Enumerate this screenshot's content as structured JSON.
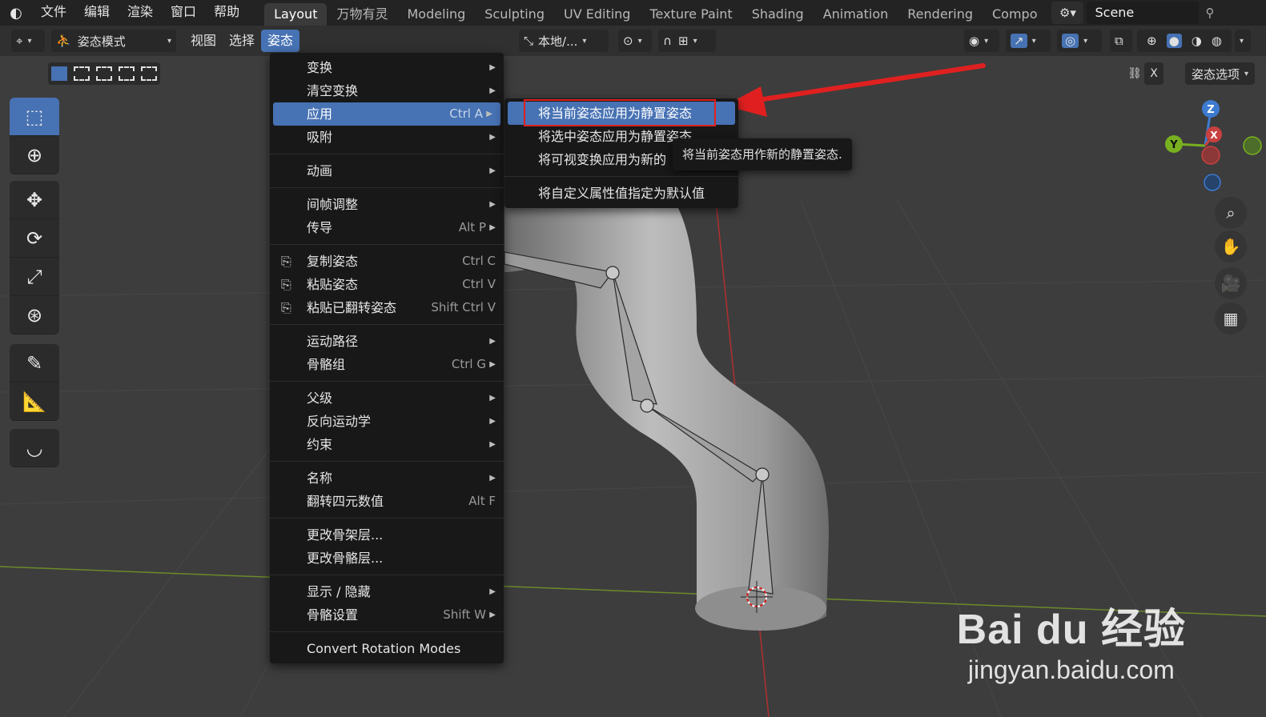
{
  "topbar": {
    "menus": [
      "文件",
      "编辑",
      "渲染",
      "窗口",
      "帮助"
    ],
    "workspaces": [
      {
        "label": "Layout",
        "active": true
      },
      {
        "label": "万物有灵",
        "active": false
      },
      {
        "label": "Modeling",
        "active": false
      },
      {
        "label": "Sculpting",
        "active": false
      },
      {
        "label": "UV Editing",
        "active": false
      },
      {
        "label": "Texture Paint",
        "active": false
      },
      {
        "label": "Shading",
        "active": false
      },
      {
        "label": "Animation",
        "active": false
      },
      {
        "label": "Rendering",
        "active": false
      },
      {
        "label": "Compo",
        "active": false
      }
    ],
    "scene": "Scene"
  },
  "header": {
    "mode": "姿态模式",
    "menus": [
      {
        "label": "视图",
        "active": false
      },
      {
        "label": "选择",
        "active": false
      },
      {
        "label": "姿态",
        "active": true
      }
    ],
    "orientation": "本地/..."
  },
  "viewport": {
    "pose_options": "姿态选项",
    "x_label": "X",
    "gizmo": {
      "z": "Z",
      "y": "Y",
      "x": "X"
    }
  },
  "pose_menu": {
    "groups": [
      [
        {
          "label": "变换",
          "shortcut": "",
          "submenu": true,
          "icon": ""
        },
        {
          "label": "清空变换",
          "shortcut": "",
          "submenu": true,
          "icon": ""
        },
        {
          "label": "应用",
          "shortcut": "Ctrl A",
          "submenu": true,
          "icon": "",
          "highlight": true
        },
        {
          "label": "吸附",
          "shortcut": "",
          "submenu": true,
          "icon": ""
        }
      ],
      [
        {
          "label": "动画",
          "shortcut": "",
          "submenu": true,
          "icon": ""
        }
      ],
      [
        {
          "label": "间帧调整",
          "shortcut": "",
          "submenu": true,
          "icon": ""
        },
        {
          "label": "传导",
          "shortcut": "Alt P",
          "submenu": true,
          "icon": ""
        }
      ],
      [
        {
          "label": "复制姿态",
          "shortcut": "Ctrl C",
          "submenu": false,
          "icon": "copy-icon"
        },
        {
          "label": "粘贴姿态",
          "shortcut": "Ctrl V",
          "submenu": false,
          "icon": "paste-icon"
        },
        {
          "label": "粘贴已翻转姿态",
          "shortcut": "Shift Ctrl V",
          "submenu": false,
          "icon": "paste-flipped-icon"
        }
      ],
      [
        {
          "label": "运动路径",
          "shortcut": "",
          "submenu": true,
          "icon": ""
        },
        {
          "label": "骨骼组",
          "shortcut": "Ctrl G",
          "submenu": true,
          "icon": ""
        }
      ],
      [
        {
          "label": "父级",
          "shortcut": "",
          "submenu": true,
          "icon": ""
        },
        {
          "label": "反向运动学",
          "shortcut": "",
          "submenu": true,
          "icon": ""
        },
        {
          "label": "约束",
          "shortcut": "",
          "submenu": true,
          "icon": ""
        }
      ],
      [
        {
          "label": "名称",
          "shortcut": "",
          "submenu": true,
          "icon": ""
        },
        {
          "label": "翻转四元数值",
          "shortcut": "Alt F",
          "submenu": false,
          "icon": ""
        }
      ],
      [
        {
          "label": "更改骨架层...",
          "shortcut": "",
          "submenu": false,
          "icon": ""
        },
        {
          "label": "更改骨骼层...",
          "shortcut": "",
          "submenu": false,
          "icon": ""
        }
      ],
      [
        {
          "label": "显示 / 隐藏",
          "shortcut": "",
          "submenu": true,
          "icon": ""
        },
        {
          "label": "骨骼设置",
          "shortcut": "Shift W",
          "submenu": true,
          "icon": ""
        }
      ],
      [
        {
          "label": "Convert Rotation Modes",
          "shortcut": "",
          "submenu": false,
          "icon": ""
        }
      ]
    ]
  },
  "apply_submenu": {
    "items": [
      {
        "label": "将当前姿态应用为静置姿态",
        "highlight": true
      },
      {
        "label": "将选中姿态应用为静置姿态",
        "highlight": false
      },
      {
        "label": "将可视变换应用为新的",
        "highlight": false
      }
    ],
    "extra": "将自定义属性值指定为默认值"
  },
  "tooltip": "将当前姿态用作新的静置姿态.",
  "watermark": {
    "brand": "Bai du 经验",
    "url": "jingyan.baidu.com"
  },
  "colors": {
    "accent": "#4772b3",
    "annotation": "#e02020",
    "menu_bg": "#181818"
  }
}
